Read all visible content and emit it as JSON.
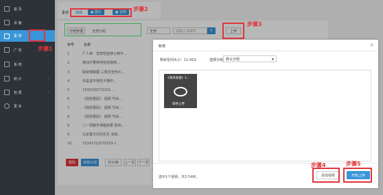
{
  "sidebar": {
    "items": [
      {
        "label": "首 页",
        "icon": "home-icon",
        "arrow": ""
      },
      {
        "label": "设 备",
        "icon": "monitor-icon",
        "arrow": ""
      },
      {
        "label": "素 材",
        "icon": "media-icon",
        "arrow": ""
      },
      {
        "label": "广 告",
        "icon": "calendar-icon",
        "arrow": "‹"
      },
      {
        "label": "系 统",
        "icon": "grid-icon",
        "arrow": "‹"
      },
      {
        "label": "统 计",
        "icon": "chart-icon",
        "arrow": "‹"
      },
      {
        "label": "权 限",
        "icon": "user-icon",
        "arrow": "‹"
      },
      {
        "label": "更 多",
        "icon": "plus-circle-icon",
        "arrow": ""
      }
    ]
  },
  "topbar": {
    "label": "素材",
    "tab_video": "视频",
    "tab_image": "● 图片",
    "tab_audio": "● 音频"
  },
  "filter": {
    "group_btn": "分组管理",
    "all_groups": "全部分组",
    "select_all": "全部",
    "search_placeholder": "请输入关键字",
    "upload_btn": "上传"
  },
  "table": {
    "col_no": "序号",
    "col_name": "名称",
    "rows": [
      {
        "no": "1",
        "name": "广人参：怎样吃能够七两半..."
      },
      {
        "no": "2",
        "name": "黄仙不要特地包括我特..."
      },
      {
        "no": "3",
        "name": "取就够截图 三周年宣传片..."
      },
      {
        "no": "4",
        "name": "你是说平常吃不懂中..."
      },
      {
        "no": "5",
        "name": "1535336772101...."
      },
      {
        "no": "6",
        "name": "《政府惠民》 视频 节目..."
      },
      {
        "no": "7",
        "name": "《政府惠民》 视频 节目..."
      },
      {
        "no": "8",
        "name": "《政府惠民》 视频 节目..."
      },
      {
        "no": "9",
        "name": "二一周教学课程效果 影响..."
      },
      {
        "no": "9",
        "name": "北京警方问问先生 有效..."
      },
      {
        "no": "10",
        "name": "15241312570153-1"
      }
    ]
  },
  "bottom_buttons": {
    "delete": "删除",
    "move": "转移分组",
    "total": "共10条",
    "prev": "上一页",
    "next": "下一页"
  },
  "modal": {
    "title": "新增",
    "space_label": "剩余空间大小：11.41G",
    "group_label": "选择分组",
    "group_value": "默认分组",
    "video_caption": "《海洋会展》1...",
    "video_status": "等待上传",
    "summary": "选中1个视频，共3.54M。",
    "add_btn": "添加视频",
    "start_btn": "开始上传"
  },
  "steps": {
    "s1": "步骤1",
    "s2": "步骤2",
    "s3": "步骤3",
    "s4": "步骤4",
    "s5": "步骤5"
  },
  "colors": {
    "sidebar": "#2d3138",
    "accent": "#3a95d8",
    "highlight": "#e0343b",
    "green_box": "#3aa655"
  }
}
